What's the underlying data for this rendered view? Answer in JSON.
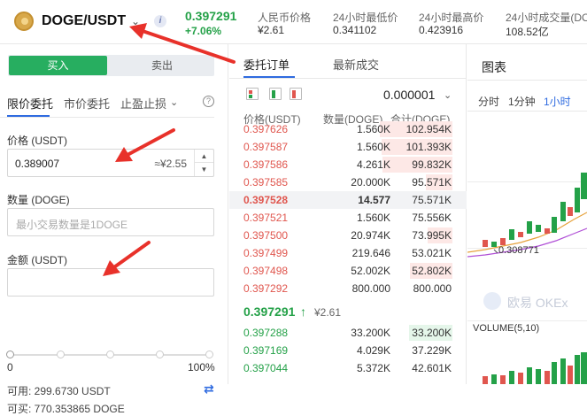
{
  "header": {
    "pair": "DOGE/USDT",
    "last_price": "0.397291",
    "change": "+7.06%",
    "stats": [
      {
        "label": "人民币价格",
        "value": "¥2.61"
      },
      {
        "label": "24小时最低价",
        "value": "0.341102"
      },
      {
        "label": "24小时最高价",
        "value": "0.423916"
      },
      {
        "label": "24小时成交量(DOGE)",
        "value": "108.52亿"
      }
    ]
  },
  "order_form": {
    "buy_label": "买入",
    "sell_label": "卖出",
    "tabs": [
      "限价委托",
      "市价委托",
      "止盈止损"
    ],
    "price_label": "价格 (USDT)",
    "price_value": "0.389007",
    "price_cny": "≈¥2.55",
    "quantity_label": "数量 (DOGE)",
    "quantity_placeholder": "最小交易数量是1DOGE",
    "amount_label": "金额 (USDT)",
    "amount_value": "",
    "slider_min": "0",
    "slider_max": "100%",
    "slider_value": 0,
    "available": "可用: 299.6730 USDT",
    "can_buy": "可买: 770.353865 DOGE"
  },
  "order_book": {
    "tabs": [
      "委托订单",
      "最新成交"
    ],
    "precision": "0.000001",
    "headers": [
      "价格(USDT)",
      "数量(DOGE)",
      "合计(DOGE)"
    ],
    "asks": [
      {
        "price": "0.397626",
        "amount": "1.560K",
        "total": "102.954K",
        "depth": 1.0
      },
      {
        "price": "0.397587",
        "amount": "1.560K",
        "total": "101.393K",
        "depth": 0.98
      },
      {
        "price": "0.397586",
        "amount": "4.261K",
        "total": "99.832K",
        "depth": 0.96
      },
      {
        "price": "0.397585",
        "amount": "20.000K",
        "total": "95.571K",
        "depth": 0.37
      },
      {
        "price": "0.397528",
        "amount": "14.577",
        "total": "75.571K",
        "depth": 0.0,
        "highlight": true
      },
      {
        "price": "0.397521",
        "amount": "1.560K",
        "total": "75.556K",
        "depth": 0.0
      },
      {
        "price": "0.397500",
        "amount": "20.974K",
        "total": "73.995K",
        "depth": 0.34
      },
      {
        "price": "0.397499",
        "amount": "219.646",
        "total": "53.021K",
        "depth": 0.0
      },
      {
        "price": "0.397498",
        "amount": "52.002K",
        "total": "52.802K",
        "depth": 0.58
      },
      {
        "price": "0.397292",
        "amount": "800.000",
        "total": "800.000",
        "depth": 0.0
      }
    ],
    "mid_price": "0.397291",
    "mid_arrow": "↑",
    "mid_cny": "¥2.61",
    "bids": [
      {
        "price": "0.397288",
        "amount": "33.200K",
        "total": "33.200K",
        "depth": 0.6
      },
      {
        "price": "0.397169",
        "amount": "4.029K",
        "total": "37.229K",
        "depth": 0.0
      },
      {
        "price": "0.397044",
        "amount": "5.372K",
        "total": "42.601K",
        "depth": 0.0
      }
    ]
  },
  "chart_panel": {
    "title": "图表",
    "intervals": [
      "分时",
      "1分钟",
      "1小时"
    ],
    "active_interval": "1小时",
    "price_marker": "0.308771",
    "watermark": "欧易 OKEx",
    "volume_label": "VOLUME(5,10)"
  },
  "colors": {
    "buy": "#27ae60",
    "up": "#24a148",
    "down": "#e0564e",
    "accent": "#2f6be0",
    "annotation": "#e8312a"
  }
}
